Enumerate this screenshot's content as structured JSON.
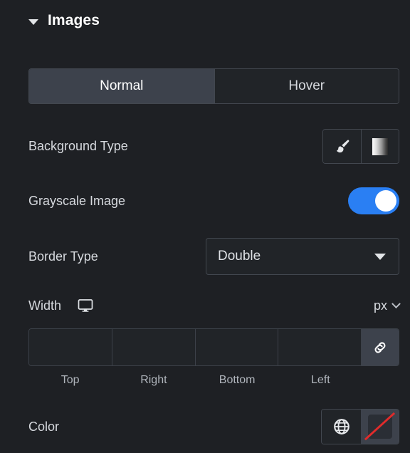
{
  "section": {
    "title": "Images",
    "collapse_icon": "caret-down-icon",
    "expanded": true
  },
  "tabs": [
    {
      "label": "Normal",
      "active": true
    },
    {
      "label": "Hover",
      "active": false
    }
  ],
  "controls": {
    "background_type": {
      "label": "Background Type",
      "options": [
        {
          "name": "classic",
          "icon": "paintbrush-icon"
        },
        {
          "name": "gradient",
          "icon": "gradient-icon"
        }
      ]
    },
    "grayscale_image": {
      "label": "Grayscale Image",
      "value": "on",
      "accent_color": "#2a7ff3"
    },
    "border_type": {
      "label": "Border Type",
      "value": "Double",
      "caret_icon": "caret-down-icon"
    },
    "width": {
      "label": "Width",
      "device_icon": "desktop-icon",
      "unit": "px",
      "unit_caret_icon": "chevron-down-icon",
      "link_icon": "link-icon",
      "fields": [
        {
          "label": "Top",
          "value": "",
          "placeholder": ""
        },
        {
          "label": "Right",
          "value": "",
          "placeholder": ""
        },
        {
          "label": "Bottom",
          "value": "",
          "placeholder": ""
        },
        {
          "label": "Left",
          "value": "",
          "placeholder": ""
        }
      ]
    },
    "color": {
      "label": "Color",
      "globe_icon": "globe-icon",
      "swatch_icon": "no-color-icon",
      "swatch_slash_color": "#e02b2b",
      "value": ""
    }
  },
  "theme": {
    "background": "#1e2024",
    "panel_border": "#42474f",
    "active_tab_background": "#3d424c",
    "text_primary": "#ffffff",
    "text_secondary": "#d6d9de"
  }
}
